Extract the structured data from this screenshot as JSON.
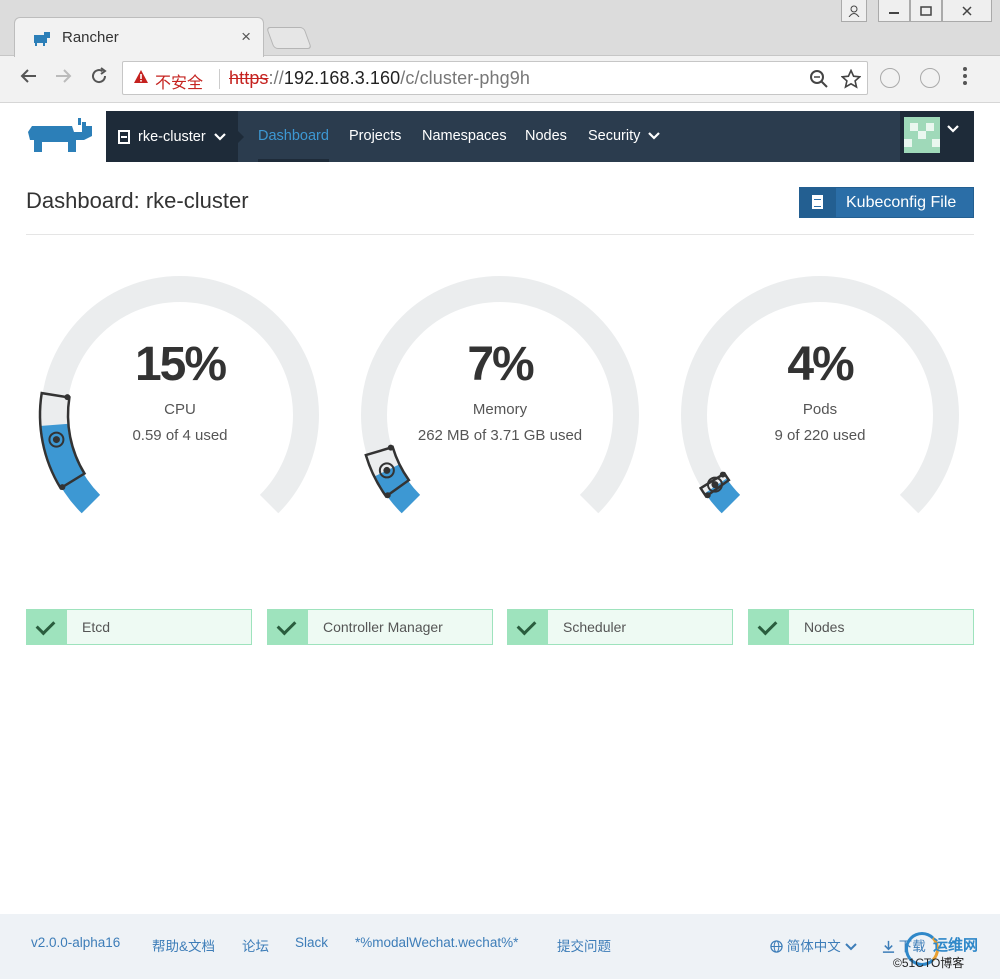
{
  "browser": {
    "tab_title": "Rancher",
    "tab_close": "×",
    "security_label": "不安全",
    "url_protocol": "https",
    "url_sep": "://",
    "url_host": "192.168.3.160",
    "url_path": "/c/cluster-phg9h"
  },
  "header": {
    "cluster_name": "rke-cluster",
    "nav": [
      "Dashboard",
      "Projects",
      "Namespaces",
      "Nodes",
      "Security"
    ],
    "active_nav": "Dashboard"
  },
  "page": {
    "title": "Dashboard: rke-cluster",
    "kubeconfig_button": "Kubeconfig File"
  },
  "gauges": [
    {
      "value": "15%",
      "label": "CPU",
      "detail": "0.59 of 4 used",
      "fraction": 0.15,
      "reserved_start": 0.05,
      "reserved_end": 0.2
    },
    {
      "value": "7%",
      "label": "Memory",
      "detail": "262 MB of 3.71 GB used",
      "fraction": 0.07,
      "reserved_start": 0.035,
      "reserved_end": 0.105
    },
    {
      "value": "4%",
      "label": "Pods",
      "detail": "9 of 220 used",
      "fraction": 0.04,
      "reserved_start": 0.035,
      "reserved_end": 0.05
    }
  ],
  "status": [
    {
      "label": "Etcd"
    },
    {
      "label": "Controller Manager"
    },
    {
      "label": "Scheduler"
    },
    {
      "label": "Nodes"
    }
  ],
  "footer": {
    "version": "v2.0.0-alpha16",
    "help": "帮助&文档",
    "forum": "论坛",
    "slack": "Slack",
    "wechat": "*%modalWechat.wechat%*",
    "issue": "提交问题",
    "language": "简体中文",
    "download": "下载"
  },
  "watermark": {
    "text": "运维网",
    "sub": "©51CTO博客"
  },
  "colors": {
    "nav_bg": "#2b3c4e",
    "accent": "#3d98d3",
    "gauge_track": "#ebedee",
    "gauge_fill": "#3d98d3",
    "status_bg": "#eefaf3",
    "status_ok": "#9ee3bd",
    "button": "#2b6ea7"
  },
  "icons": [
    "rancher-cow-logo",
    "server-icon",
    "chevron-down-icon",
    "file-icon",
    "check-icon",
    "globe-icon",
    "download-icon",
    "zoom-icon",
    "star-icon",
    "warning-icon"
  ]
}
